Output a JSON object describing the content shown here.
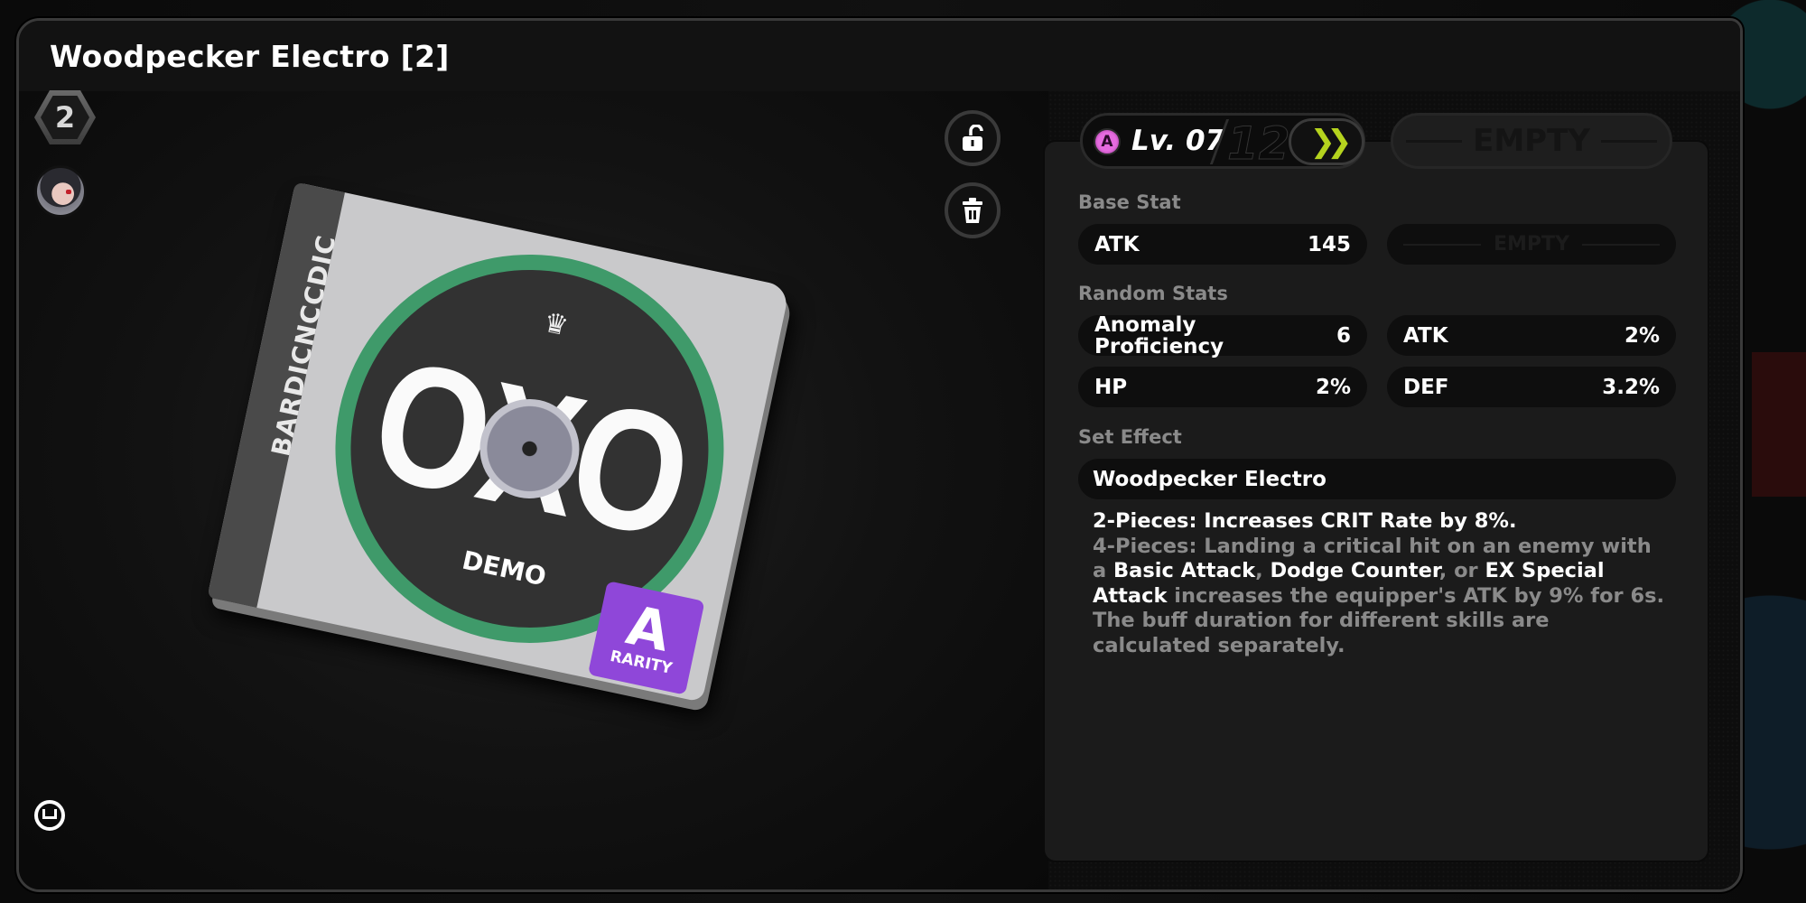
{
  "title": "Woodpecker Electro [2]",
  "left": {
    "slot_badge": "2",
    "equipped_agent": "agent-portrait",
    "disc": {
      "spine_text": "BARDICNCCDIC",
      "disc_title": "OXO",
      "disc_subtitle": "DEMO",
      "crown": "♛",
      "rarity_letter": "A",
      "rarity_label": "RARITY",
      "rarity_color": "#8f47d9",
      "ring_color": "#3f9a6a"
    }
  },
  "actions": {
    "lock_icon": "unlock-icon",
    "delete_icon": "trash-icon",
    "info_icon": "info-icon"
  },
  "level": {
    "rank": "A",
    "rank_color": "#e56bdf",
    "current": "Lv. 07",
    "max": "12",
    "upgrade_icon": "double-chevron-right-icon",
    "upgrade_color": "#b5d31e"
  },
  "empty_slot_label": "EMPTY",
  "base_stat": {
    "label": "Base Stat",
    "stats": [
      {
        "name": "ATK",
        "value": "145"
      }
    ],
    "empty_label": "EMPTY"
  },
  "random_stats": {
    "label": "Random Stats",
    "stats": [
      {
        "name": "Anomaly Proficiency",
        "value": "6"
      },
      {
        "name": "ATK",
        "value": "2%"
      },
      {
        "name": "HP",
        "value": "2%"
      },
      {
        "name": "DEF",
        "value": "3.2%"
      }
    ]
  },
  "set_effect": {
    "label": "Set Effect",
    "name": "Woodpecker Electro",
    "two_piece": "2-Pieces: Increases CRIT Rate by 8%.",
    "four_piece": {
      "prefix": "4-Pieces: Landing a critical hit on an enemy with a ",
      "kw1": "Basic Attack",
      "sep1": ", ",
      "kw2": "Dodge Counter",
      "sep2": ", or ",
      "kw3": "EX Special Attack",
      "suffix": " increases the equipper's ATK by 9% for 6s. The buff duration for different skills are calculated separately."
    }
  }
}
